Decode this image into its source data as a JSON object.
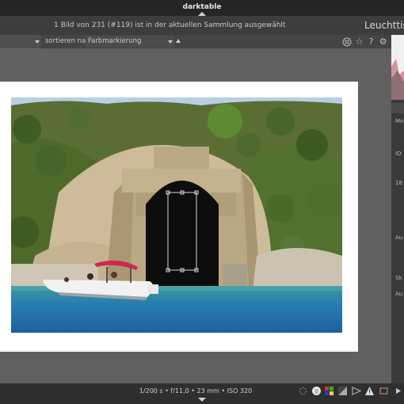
{
  "app": {
    "title": "darktable"
  },
  "info": {
    "message": "1 Bild von 231 (#119) ist in der aktuellen Sammlung ausgewählt",
    "module_title": "Leuchttisch"
  },
  "toolbar": {
    "sort_label": "sortieren nach",
    "sort_value": "Farbmarkierung"
  },
  "right_panel": {
    "items": [
      "Mo",
      "IO",
      "18",
      "Au",
      "Sk",
      "Au"
    ]
  },
  "status": {
    "exif": "1/200 s • f/11,0 • 23 mm • ISO 320"
  },
  "icons": [
    "grid-icon",
    "star-icon",
    "help-icon",
    "gear-icon",
    "focus-peaking-icon",
    "color-assessment-icon",
    "overexposure-icon",
    "softproof-icon",
    "gamut-check-icon",
    "warning-icon",
    "expand-arrow-icon"
  ],
  "colors": {
    "accent_red": "#d0284a",
    "water": "#1d5fa0"
  }
}
